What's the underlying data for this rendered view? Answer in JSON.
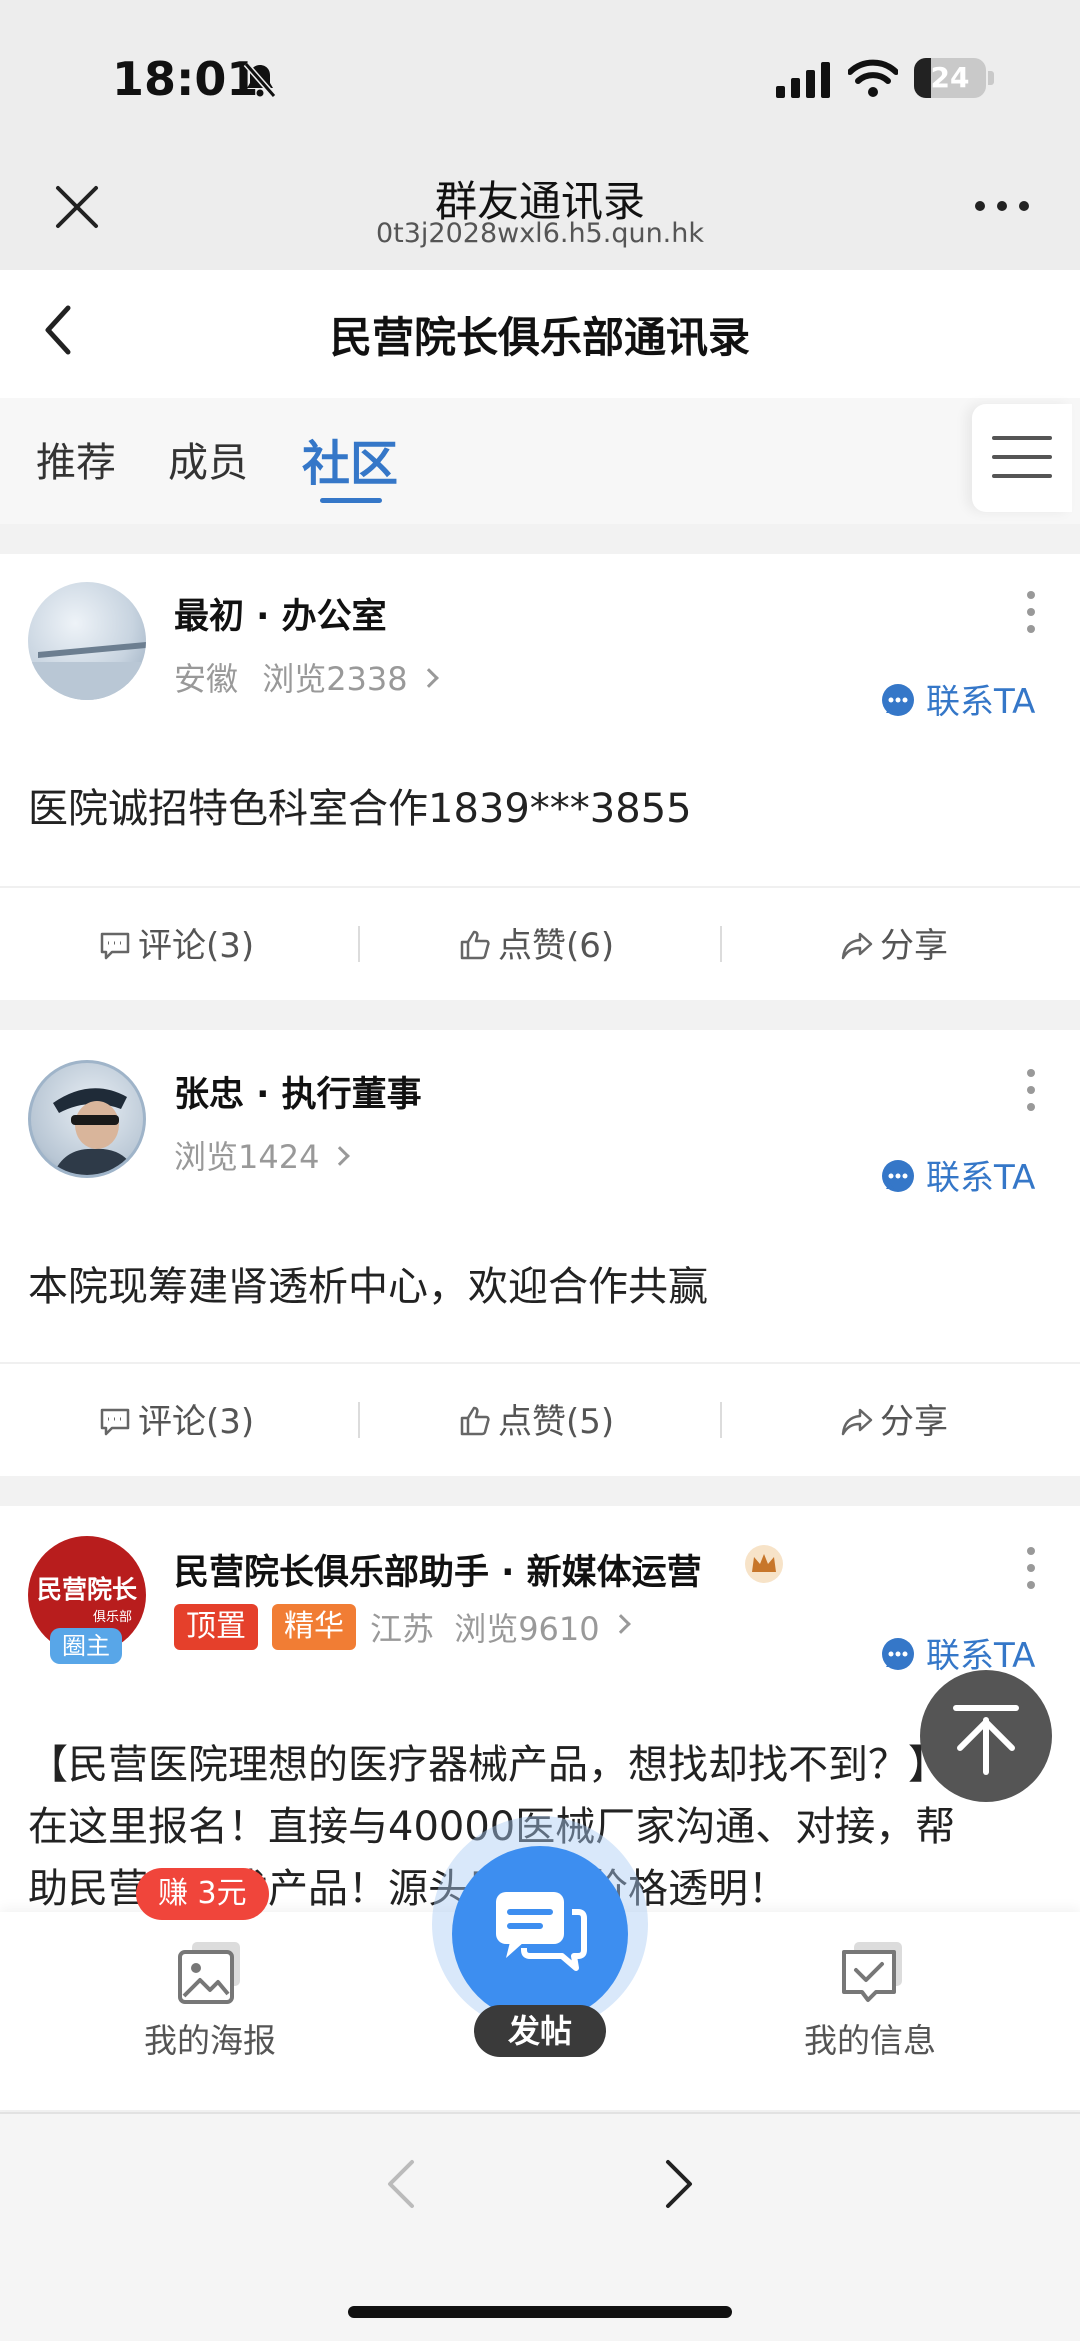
{
  "status_bar": {
    "time": "18:01",
    "battery": "24",
    "battery_level": 0.24
  },
  "browser": {
    "title": "群友通讯录",
    "url": "0t3j2028wxl6.h5.qun.hk"
  },
  "page": {
    "title": "民营院长俱乐部通讯录"
  },
  "tabs": [
    {
      "label": "推荐",
      "active": false
    },
    {
      "label": "成员",
      "active": false
    },
    {
      "label": "社区",
      "active": true
    }
  ],
  "posts": [
    {
      "author": "最初 · 办公室",
      "location": "安徽",
      "views": "浏览2338",
      "contact": "联系TA",
      "text": "医院诚招特色科室合作1839***3855",
      "comment": "评论(3)",
      "like": "点赞(6)",
      "share": "分享"
    },
    {
      "author": "张忠 · 执行董事",
      "views": "浏览1424",
      "contact": "联系TA",
      "text": "本院现筹建肾透析中心，欢迎合作共赢",
      "comment": "评论(3)",
      "like": "点赞(5)",
      "share": "分享"
    },
    {
      "author": "民营院长俱乐部助手 · 新媒体运营",
      "tag_top": "顶置",
      "tag_elite": "精华",
      "location": "江苏",
      "views": "浏览9610",
      "contact": "联系TA",
      "avatar_text": "民营院长",
      "avatar_subtext": "俱乐部",
      "owner_badge": "圈主",
      "text_line1": "【民营医院理想的医疗器械产品，想找却找不到？】",
      "text_line2": "在这里报名！直接与40000医械厂家沟通、对接，帮",
      "text_line3": "助民营医院找产品！源头厂家，价格透明！"
    }
  ],
  "bottom_bar": {
    "poster": "我的海报",
    "earn_badge": "赚 3元",
    "post": "发帖",
    "messages": "我的信息"
  },
  "colors": {
    "accent": "#3577c8",
    "post_button": "#3d8ef0",
    "tag_top": "#e5402b",
    "tag_elite": "#f17d34",
    "earn": "#f0453b"
  },
  "icons": [
    "bell-slash-icon",
    "signal-icon",
    "wifi-icon",
    "close-icon",
    "more-icon",
    "back-icon",
    "menu-icon",
    "kebab-icon",
    "chat-icon",
    "comment-icon",
    "thumbs-up-icon",
    "share-icon",
    "crown-icon",
    "arrow-up-icon",
    "image-icon",
    "message-icon",
    "chevron-left-icon",
    "chevron-right-icon"
  ]
}
